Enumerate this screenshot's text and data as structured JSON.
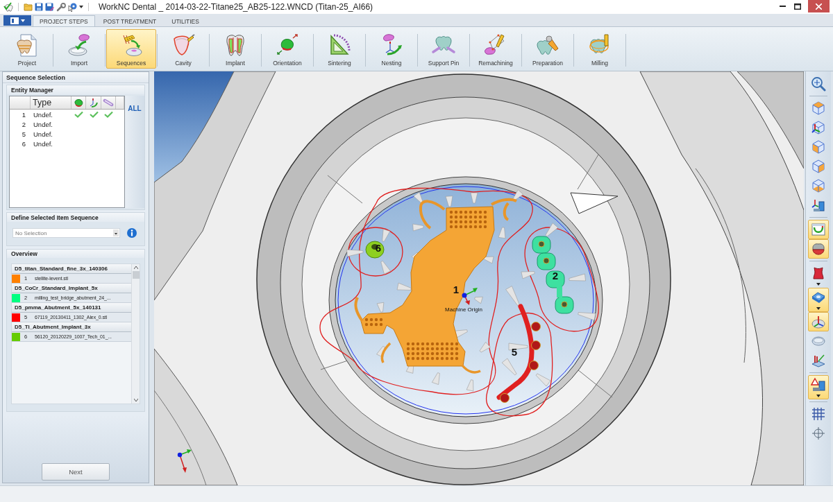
{
  "title_bar": {
    "title": "WorkNC Dental _ 2014-03-22-Titane25_AB25-122.WNCD (Titan-25_AI66)"
  },
  "tabs": [
    {
      "label": "PROJECT STEPS",
      "selected": true
    },
    {
      "label": "POST TREATMENT",
      "selected": false
    },
    {
      "label": "UTILITIES",
      "selected": false
    }
  ],
  "ribbon": [
    {
      "kind": "project",
      "label": "Project",
      "selected": false
    },
    {
      "kind": "import",
      "label": "Import",
      "selected": false
    },
    {
      "kind": "sequences",
      "label": "Sequences",
      "selected": true
    },
    {
      "kind": "cavity",
      "label": "Cavity",
      "selected": false
    },
    {
      "kind": "implant",
      "label": "Implant",
      "selected": false
    },
    {
      "kind": "orientation",
      "label": "Orientation",
      "selected": false
    },
    {
      "kind": "sintering",
      "label": "Sintering",
      "selected": false
    },
    {
      "kind": "nesting",
      "label": "Nesting",
      "selected": false
    },
    {
      "kind": "support_pin",
      "label": "Support Pin",
      "selected": false
    },
    {
      "kind": "remachining",
      "label": "Remachining",
      "selected": false
    },
    {
      "kind": "preparation",
      "label": "Preparation",
      "selected": false
    },
    {
      "kind": "milling",
      "label": "Milling",
      "selected": false
    }
  ],
  "sequence_selection": {
    "title": "Sequence Selection",
    "entity_manager": {
      "title": "Entity Manager",
      "columns": [
        {
          "kind": "type",
          "label": "Type"
        },
        {
          "kind": "model"
        },
        {
          "kind": "orientation"
        },
        {
          "kind": "support"
        }
      ],
      "rows": [
        {
          "number": "1",
          "type": "Undef.",
          "checks": [
            true,
            true,
            true
          ]
        },
        {
          "number": "2",
          "type": "Undef.",
          "checks": [
            false,
            false,
            false
          ]
        },
        {
          "number": "5",
          "type": "Undef.",
          "checks": [
            false,
            false,
            false
          ]
        },
        {
          "number": "6",
          "type": "Undef.",
          "checks": [
            false,
            false,
            false
          ]
        }
      ],
      "all_button": "ALL"
    },
    "item_sequence": {
      "title": "Define Selected Item Sequence",
      "dropdown": {
        "value": "No Selection"
      }
    },
    "overview": {
      "title": "Overview",
      "groups": [
        {
          "name": "D5_titan_Standard_fine_3x_140306",
          "items": [
            {
              "number": "1",
              "file": "stellite-levent.stl",
              "color": "#ff8000"
            }
          ]
        },
        {
          "name": "D5_CoCr_Standard_Implant_5x",
          "items": [
            {
              "number": "2",
              "file": "milling_test_bridge_abutment_24_...",
              "color": "#00ff80"
            }
          ]
        },
        {
          "name": "D5_pmma_Abutment_5x_140131",
          "items": [
            {
              "number": "5",
              "file": "67119_20130411_1302_Alex_0.stl",
              "color": "#ff0000"
            }
          ]
        },
        {
          "name": "D5_Ti_Abutment_Implant_3x",
          "items": [
            {
              "number": "6",
              "file": "56120_20120229_1007_Tech_01_...",
              "color": "#66cc00"
            }
          ]
        }
      ]
    },
    "next_button": "Next"
  },
  "viewport": {
    "parts": [
      {
        "kind": "framework",
        "label": "1"
      },
      {
        "kind": "bridge",
        "label": "2"
      },
      {
        "kind": "bar",
        "label": "5"
      },
      {
        "kind": "abutment",
        "label": "6"
      }
    ],
    "origin_label": "Machine Origin"
  },
  "view_toolbar": [
    {
      "tools": [
        {
          "kind": "zoom",
          "selected": false,
          "menu": false
        }
      ]
    },
    {
      "tools": [
        {
          "kind": "iso_view",
          "selected": false,
          "menu": false
        },
        {
          "kind": "axes_view",
          "selected": false,
          "menu": false
        },
        {
          "kind": "front_view",
          "selected": false,
          "menu": false
        },
        {
          "kind": "side_view",
          "selected": false,
          "menu": false
        },
        {
          "kind": "bottom_view",
          "selected": false,
          "menu": false
        },
        {
          "kind": "machine_axes",
          "selected": false,
          "menu": false
        }
      ]
    },
    {
      "tools": [
        {
          "kind": "toolpath",
          "selected": true,
          "menu": false
        },
        {
          "kind": "model",
          "selected": true,
          "menu": false
        }
      ]
    },
    {
      "tools": [
        {
          "kind": "stock",
          "selected": false,
          "menu": true
        },
        {
          "kind": "plate",
          "selected": true,
          "menu": true
        },
        {
          "kind": "origin",
          "selected": true,
          "menu": false
        },
        {
          "kind": "disc",
          "selected": false,
          "menu": false
        },
        {
          "kind": "tools",
          "selected": false,
          "menu": false
        }
      ]
    },
    {
      "tools": [
        {
          "kind": "collision",
          "selected": true,
          "menu": true
        }
      ]
    },
    {
      "tools": [
        {
          "kind": "grid",
          "selected": false,
          "menu": false
        },
        {
          "kind": "crosshair",
          "selected": false,
          "menu": false
        }
      ]
    }
  ]
}
